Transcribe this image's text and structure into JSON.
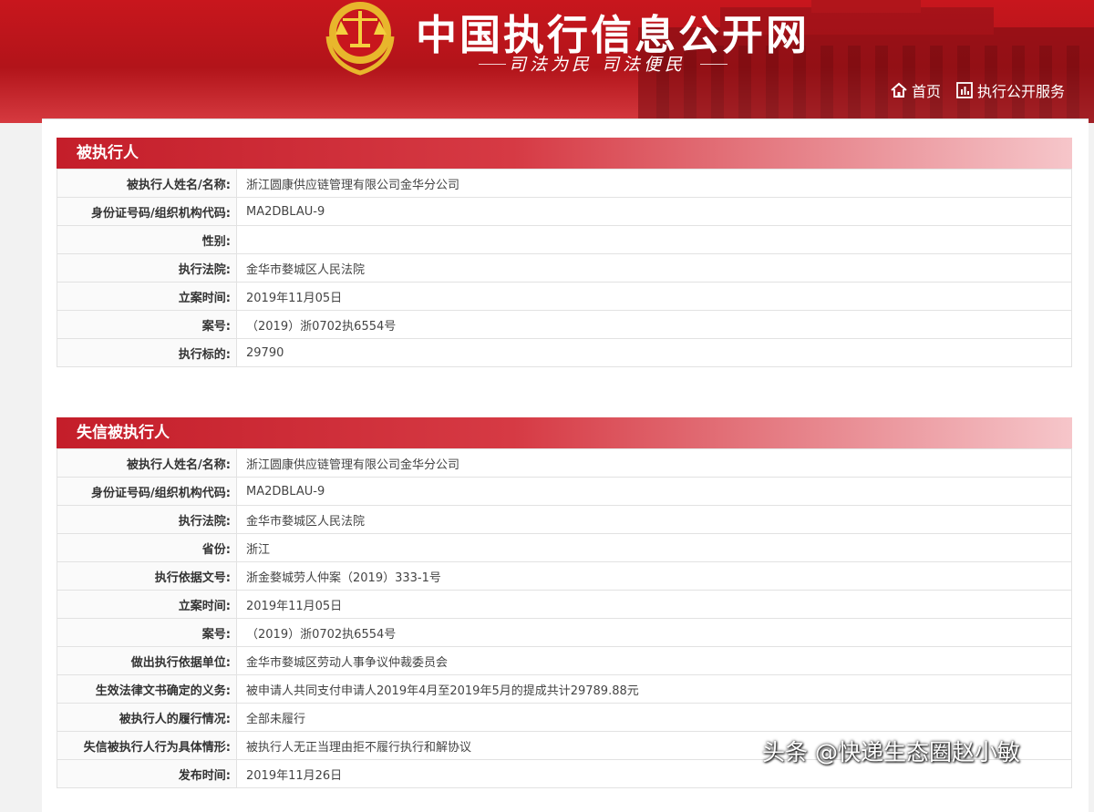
{
  "header": {
    "site_title": "中国执行信息公开网",
    "slogan": "司法为民  司法便民",
    "nav": [
      {
        "label": "首页",
        "icon": "home-icon"
      },
      {
        "label": "执行公开服务",
        "icon": "bar-chart-icon"
      }
    ]
  },
  "section1": {
    "title": "被执行人",
    "rows": [
      {
        "label": "被执行人姓名/名称:",
        "value": "浙江圆康供应链管理有限公司金华分公司"
      },
      {
        "label": "身份证号码/组织机构代码:",
        "value": "MA2DBLAU-9"
      },
      {
        "label": "性别:",
        "value": ""
      },
      {
        "label": "执行法院:",
        "value": "金华市婺城区人民法院"
      },
      {
        "label": "立案时间:",
        "value": "2019年11月05日"
      },
      {
        "label": "案号:",
        "value": "（2019）浙0702执6554号"
      },
      {
        "label": "执行标的:",
        "value": "29790"
      }
    ]
  },
  "section2": {
    "title": "失信被执行人",
    "rows": [
      {
        "label": "被执行人姓名/名称:",
        "value": "浙江圆康供应链管理有限公司金华分公司"
      },
      {
        "label": "身份证号码/组织机构代码:",
        "value": "MA2DBLAU-9"
      },
      {
        "label": "执行法院:",
        "value": "金华市婺城区人民法院"
      },
      {
        "label": "省份:",
        "value": "浙江"
      },
      {
        "label": "执行依据文号:",
        "value": "浙金婺城劳人仲案（2019）333-1号"
      },
      {
        "label": "立案时间:",
        "value": "2019年11月05日"
      },
      {
        "label": "案号:",
        "value": "（2019）浙0702执6554号"
      },
      {
        "label": "做出执行依据单位:",
        "value": "金华市婺城区劳动人事争议仲裁委员会"
      },
      {
        "label": "生效法律文书确定的义务:",
        "value": "被申请人共同支付申请人2019年4月至2019年5月的提成共计29789.88元"
      },
      {
        "label": "被执行人的履行情况:",
        "value": "全部未履行"
      },
      {
        "label": "失信被执行人行为具体情形:",
        "value": "被执行人无正当理由拒不履行执行和解协议"
      },
      {
        "label": "发布时间:",
        "value": "2019年11月26日"
      }
    ]
  },
  "watermark": "头条 @快递生态圈赵小敏"
}
